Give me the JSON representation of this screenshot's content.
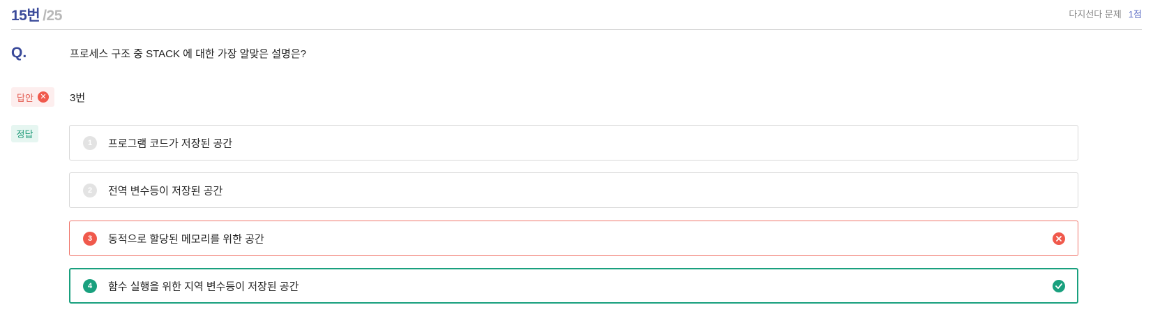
{
  "header": {
    "question_number": "15번",
    "total": "/25",
    "question_type": "다지선다 문제",
    "points": "1점"
  },
  "question": {
    "label": "Q.",
    "text": "프로세스 구조 중 STACK 에 대한 가장 알맞은 설명은?"
  },
  "answer": {
    "label": "답안",
    "value": "3번",
    "status": "incorrect"
  },
  "correct": {
    "label": "정답"
  },
  "options": [
    {
      "number": "1",
      "text": "프로그램 코드가 저장된 공간",
      "state": "neutral"
    },
    {
      "number": "2",
      "text": "전역 변수등이 저장된 공간",
      "state": "neutral"
    },
    {
      "number": "3",
      "text": "동적으로 할당된 메모리를 위한 공간",
      "state": "wrong",
      "icon": "x-circle-icon"
    },
    {
      "number": "4",
      "text": "함수 실행을 위한 지역 변수등이 저장된 공간",
      "state": "correct",
      "icon": "check-circle-icon"
    }
  ],
  "colors": {
    "accent": "#3a4a9a",
    "wrong": "#f0594c",
    "correct": "#19a07e"
  }
}
